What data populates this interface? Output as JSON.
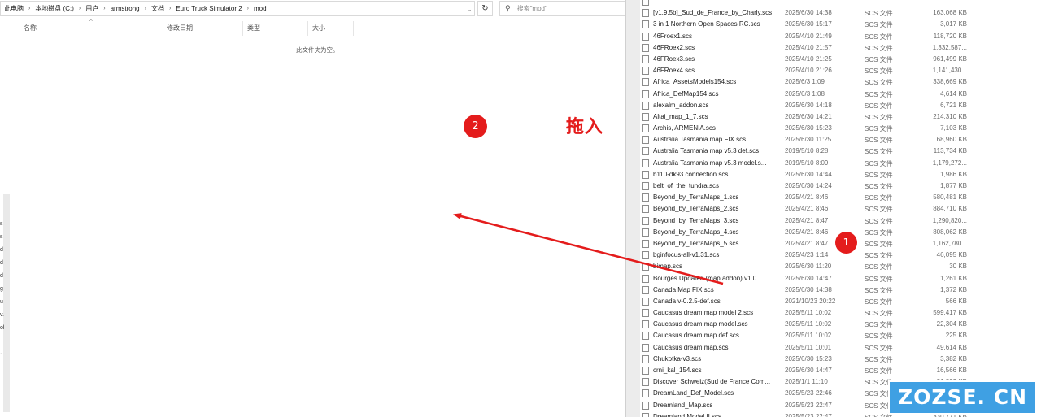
{
  "left_window": {
    "breadcrumbs": [
      "此电脑",
      "本地磁盘 (C:)",
      "用户",
      "armstrong",
      "文档",
      "Euro Truck Simulator 2",
      "mod"
    ],
    "search_placeholder": "搜索\"mod\"",
    "columns": {
      "name": "名称",
      "modified": "修改日期",
      "type": "类型",
      "size": "大小"
    },
    "empty_message": "此文件夹为空。",
    "nav_chars": [
      "s",
      "s",
      "d",
      "d",
      "d",
      "g",
      "u",
      "v.",
      "ol",
      "·"
    ]
  },
  "annotations": {
    "drop_number": "2",
    "drag_in_label": "拖入",
    "list_number": "1",
    "arrow_color": "#e41c1c"
  },
  "right_window": {
    "files": [
      {
        "name": "",
        "date": "",
        "type": "",
        "size": ""
      },
      {
        "name": "[v1.9.5b]_Sud_de_France_by_Charly.scs",
        "date": "2025/6/30 14:38",
        "type": "SCS 文件",
        "size": "163,068 KB"
      },
      {
        "name": "3 in 1 Northern Open Spaces RC.scs",
        "date": "2025/6/30 15:17",
        "type": "SCS 文件",
        "size": "3,017 KB"
      },
      {
        "name": "46Froex1.scs",
        "date": "2025/4/10 21:49",
        "type": "SCS 文件",
        "size": "118,720 KB"
      },
      {
        "name": "46FRoex2.scs",
        "date": "2025/4/10 21:57",
        "type": "SCS 文件",
        "size": "1,332,587..."
      },
      {
        "name": "46FRoex3.scs",
        "date": "2025/4/10 21:25",
        "type": "SCS 文件",
        "size": "961,499 KB"
      },
      {
        "name": "46FRoex4.scs",
        "date": "2025/4/10 21:26",
        "type": "SCS 文件",
        "size": "1,141,430..."
      },
      {
        "name": "Africa_AssetsModels154.scs",
        "date": "2025/6/3 1:09",
        "type": "SCS 文件",
        "size": "338,669 KB"
      },
      {
        "name": "Africa_DefMap154.scs",
        "date": "2025/6/3 1:08",
        "type": "SCS 文件",
        "size": "4,614 KB"
      },
      {
        "name": "alexalm_addon.scs",
        "date": "2025/6/30 14:18",
        "type": "SCS 文件",
        "size": "6,721 KB"
      },
      {
        "name": "Altai_map_1_7.scs",
        "date": "2025/6/30 14:21",
        "type": "SCS 文件",
        "size": "214,310 KB"
      },
      {
        "name": "Archis, ARMENIA.scs",
        "date": "2025/6/30 15:23",
        "type": "SCS 文件",
        "size": "7,103 KB"
      },
      {
        "name": "Australia Tasmania map FIX.scs",
        "date": "2025/6/30 11:25",
        "type": "SCS 文件",
        "size": "68,960 KB"
      },
      {
        "name": "Australia Tasmania map v5.3 def.scs",
        "date": "2019/5/10 8:28",
        "type": "SCS 文件",
        "size": "113,734 KB"
      },
      {
        "name": "Australia Tasmania map v5.3 model.s...",
        "date": "2019/5/10 8:09",
        "type": "SCS 文件",
        "size": "1,179,272..."
      },
      {
        "name": "b110-dk93 connection.scs",
        "date": "2025/6/30 14:44",
        "type": "SCS 文件",
        "size": "1,986 KB"
      },
      {
        "name": "belt_of_the_tundra.scs",
        "date": "2025/6/30 14:24",
        "type": "SCS 文件",
        "size": "1,877 KB"
      },
      {
        "name": "Beyond_by_TerraMaps_1.scs",
        "date": "2025/4/21 8:46",
        "type": "SCS 文件",
        "size": "580,481 KB"
      },
      {
        "name": "Beyond_by_TerraMaps_2.scs",
        "date": "2025/4/21 8:46",
        "type": "SCS 文件",
        "size": "884,710 KB"
      },
      {
        "name": "Beyond_by_TerraMaps_3.scs",
        "date": "2025/4/21 8:47",
        "type": "SCS 文件",
        "size": "1,290,820..."
      },
      {
        "name": "Beyond_by_TerraMaps_4.scs",
        "date": "2025/4/21 8:46",
        "type": "SCS 文件",
        "size": "808,062 KB"
      },
      {
        "name": "Beyond_by_TerraMaps_5.scs",
        "date": "2025/4/21 8:47",
        "type": "SCS 文件",
        "size": "1,162,780..."
      },
      {
        "name": "bginfocus-all-v1.31.scs",
        "date": "2025/4/23 1:14",
        "type": "SCS 文件",
        "size": "46,095 KB"
      },
      {
        "name": "bimap.scs",
        "date": "2025/6/30 11:20",
        "type": "SCS 文件",
        "size": "30 KB"
      },
      {
        "name": "Bourges Updated (map addon) v1.0....",
        "date": "2025/6/30 14:47",
        "type": "SCS 文件",
        "size": "1,261 KB"
      },
      {
        "name": "Canada Map FIX.scs",
        "date": "2025/6/30 14:38",
        "type": "SCS 文件",
        "size": "1,372 KB"
      },
      {
        "name": "Canada v-0.2.5-def.scs",
        "date": "2021/10/23 20:22",
        "type": "SCS 文件",
        "size": "566 KB"
      },
      {
        "name": "Caucasus dream map model 2.scs",
        "date": "2025/5/11 10:02",
        "type": "SCS 文件",
        "size": "599,417 KB"
      },
      {
        "name": "Caucasus dream map model.scs",
        "date": "2025/5/11 10:02",
        "type": "SCS 文件",
        "size": "22,304 KB"
      },
      {
        "name": "Caucasus dream map.def.scs",
        "date": "2025/5/11 10:02",
        "type": "SCS 文件",
        "size": "225 KB"
      },
      {
        "name": "Caucasus dream map.scs",
        "date": "2025/5/11 10:01",
        "type": "SCS 文件",
        "size": "49,614 KB"
      },
      {
        "name": "Chukotka-v3.scs",
        "date": "2025/6/30 15:23",
        "type": "SCS 文件",
        "size": "3,382 KB"
      },
      {
        "name": "crni_kal_154.scs",
        "date": "2025/6/30 14:47",
        "type": "SCS 文件",
        "size": "16,566 KB"
      },
      {
        "name": "Discover Schweiz(Sud de France Com...",
        "date": "2025/1/1 11:10",
        "type": "SCS 文件",
        "size": "21,829 KB"
      },
      {
        "name": "DreamLand_Def_Model.scs",
        "date": "2025/5/23 22:46",
        "type": "SCS 文件",
        "size": ""
      },
      {
        "name": "Dreamland_Map.scs",
        "date": "2025/5/23 22:47",
        "type": "SCS 文件",
        "size": ""
      },
      {
        "name": "Dreamland Model II.scs",
        "date": "2025/5/23 22:47",
        "type": "SCS 文件",
        "size": "330,771 KB"
      }
    ]
  },
  "watermark": {
    "text": "ZOZSE. CN"
  }
}
